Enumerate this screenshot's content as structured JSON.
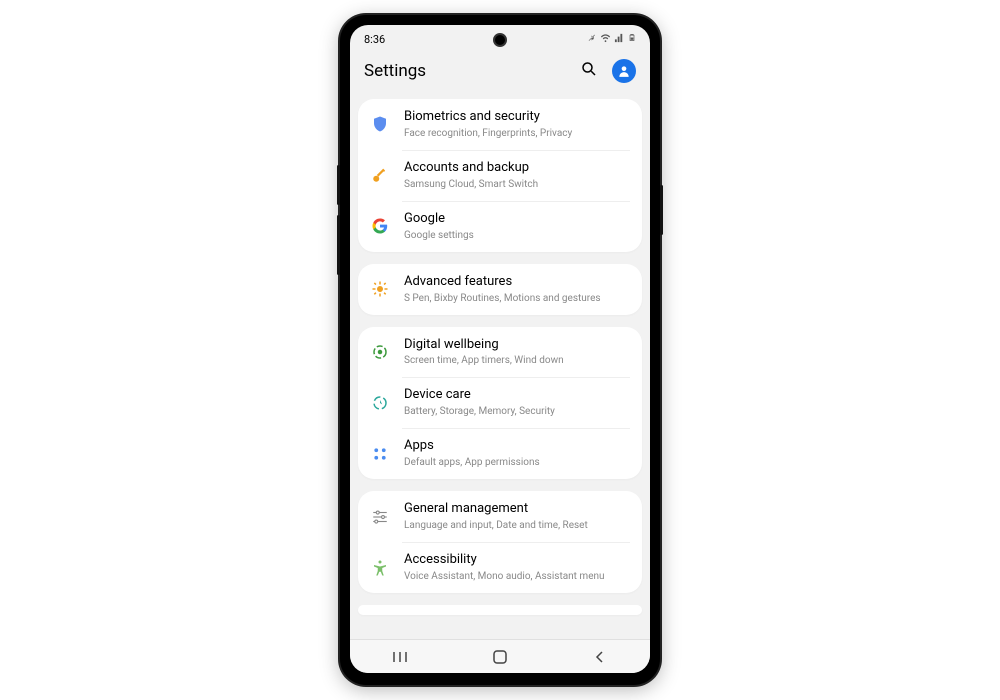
{
  "status": {
    "time": "8:36",
    "icons": [
      "mute-icon",
      "wifi-icon",
      "signal-icon",
      "battery-icon"
    ]
  },
  "header": {
    "title": "Settings"
  },
  "groups": [
    {
      "items": [
        {
          "icon": "shield-icon",
          "color": "#5b8def",
          "title": "Biometrics and security",
          "sub": "Face recognition, Fingerprints, Privacy"
        },
        {
          "icon": "key-icon",
          "color": "#f0a020",
          "title": "Accounts and backup",
          "sub": "Samsung Cloud, Smart Switch"
        },
        {
          "icon": "google-icon",
          "color": "#4285f4",
          "title": "Google",
          "sub": "Google settings"
        }
      ]
    },
    {
      "items": [
        {
          "icon": "gear-plus-icon",
          "color": "#f0a020",
          "title": "Advanced features",
          "sub": "S Pen, Bixby Routines, Motions and gestures"
        }
      ]
    },
    {
      "items": [
        {
          "icon": "wellbeing-icon",
          "color": "#3c9a3c",
          "title": "Digital wellbeing",
          "sub": "Screen time, App timers, Wind down"
        },
        {
          "icon": "device-care-icon",
          "color": "#2aa79b",
          "title": "Device care",
          "sub": "Battery, Storage, Memory, Security"
        },
        {
          "icon": "apps-grid-icon",
          "color": "#4a8cf0",
          "title": "Apps",
          "sub": "Default apps, App permissions"
        }
      ]
    },
    {
      "items": [
        {
          "icon": "sliders-icon",
          "color": "#888",
          "title": "General management",
          "sub": "Language and input, Date and time, Reset"
        },
        {
          "icon": "accessibility-icon",
          "color": "#7bbf6a",
          "title": "Accessibility",
          "sub": "Voice Assistant, Mono audio, Assistant menu"
        }
      ]
    },
    {
      "items": []
    }
  ],
  "nav": [
    "recent",
    "home",
    "back"
  ]
}
